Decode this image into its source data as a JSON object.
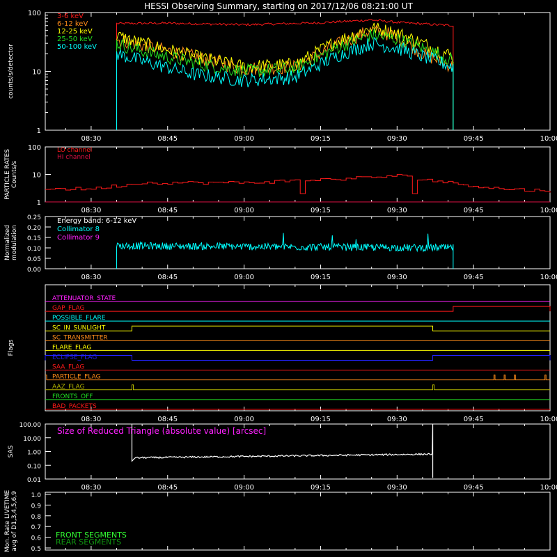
{
  "title": "HESSI Observing Summary, starting on 2017/12/06 08:21:00 UT",
  "time_ticks": [
    "08:30",
    "08:45",
    "09:00",
    "09:15",
    "09:30",
    "09:45",
    "10:00"
  ],
  "colors": {
    "bg": "#000000",
    "axis": "#ffffff",
    "red": "#ff1a1a",
    "orange": "#ff8c1a",
    "yellow": "#ffff00",
    "green": "#22dd22",
    "cyan": "#00ffff",
    "magenta": "#ff22ff",
    "blue": "#2222ff",
    "olive": "#b3b300",
    "crimson": "#dd1144",
    "lightgreen": "#33ff33",
    "darkgreen": "#119911"
  },
  "chart_data": [
    {
      "type": "line",
      "ylabel": "counts/s/detector",
      "yscale": "log",
      "ylim": [
        1,
        100
      ],
      "ytick_labels": [
        "1",
        "10",
        "100"
      ],
      "xlim": [
        "08:21",
        "10:00"
      ],
      "series": [
        {
          "name": "3-6 keV",
          "color": "#ff1a1a",
          "x": [
            "08:35",
            "08:45",
            "09:00",
            "09:15",
            "09:25",
            "09:30",
            "09:41"
          ],
          "values": [
            65,
            66,
            62,
            67,
            75,
            68,
            60
          ]
        },
        {
          "name": "6-12 keV",
          "color": "#ff8c1a",
          "x": [
            "08:35",
            "08:40",
            "08:50",
            "09:00",
            "09:10",
            "09:18",
            "09:25",
            "09:30",
            "09:35",
            "09:41"
          ],
          "values": [
            35,
            28,
            18,
            11,
            12,
            28,
            50,
            40,
            20,
            12
          ]
        },
        {
          "name": "12-25 keV",
          "color": "#ffff00",
          "x": [
            "08:35",
            "08:40",
            "08:50",
            "09:00",
            "09:10",
            "09:18",
            "09:25",
            "09:30",
            "09:35",
            "09:41"
          ],
          "values": [
            40,
            30,
            18,
            12,
            13,
            32,
            55,
            45,
            30,
            18
          ]
        },
        {
          "name": "25-50 keV",
          "color": "#22dd22",
          "x": [
            "08:35",
            "08:40",
            "08:50",
            "09:00",
            "09:10",
            "09:18",
            "09:25",
            "09:30",
            "09:35",
            "09:41"
          ],
          "values": [
            30,
            22,
            14,
            10,
            11,
            25,
            42,
            35,
            25,
            15
          ]
        },
        {
          "name": "50-100 keV",
          "color": "#00ffff",
          "x": [
            "08:35",
            "08:40",
            "08:50",
            "09:00",
            "09:10",
            "09:18",
            "09:25",
            "09:30",
            "09:35",
            "09:41"
          ],
          "values": [
            20,
            15,
            9,
            7,
            8,
            18,
            30,
            25,
            18,
            12
          ]
        }
      ]
    },
    {
      "type": "line",
      "ylabel_lines": [
        "PARTICLE RATES",
        "Counts/s"
      ],
      "yscale": "log",
      "ylim": [
        1,
        100
      ],
      "ytick_labels": [
        "1",
        "10",
        "100"
      ],
      "series": [
        {
          "name": "LO channel",
          "color": "#ff1a1a",
          "x": [
            "08:21",
            "08:30",
            "08:40",
            "09:00",
            "09:20",
            "09:30",
            "09:40",
            "09:50",
            "10:00"
          ],
          "values": [
            3,
            3,
            5,
            5,
            7,
            9,
            5,
            3,
            2.5
          ]
        },
        {
          "name": "HI channel",
          "color": "#dd1144",
          "x": [
            "08:21",
            "10:00"
          ],
          "values": [
            1,
            1
          ]
        }
      ]
    },
    {
      "type": "line",
      "ylabel_lines": [
        "Normalized",
        "modulation"
      ],
      "ylim": [
        0,
        0.25
      ],
      "ytick_labels": [
        "0.00",
        "0.05",
        "0.10",
        "0.15",
        "0.20",
        "0.25"
      ],
      "annotation": "Energy band: 6-12 keV",
      "series": [
        {
          "name": "Collimator 8",
          "color": "#00ffff",
          "x": [
            "08:35",
            "09:41"
          ],
          "values": [
            0.11,
            0.1
          ]
        },
        {
          "name": "Collimator 9",
          "color": "#ff22ff",
          "x": [],
          "values": []
        }
      ]
    },
    {
      "type": "flags",
      "ylabel": "Flags",
      "flags": [
        {
          "name": "ATTENUATOR_STATE",
          "color": "#ff22ff",
          "segments": []
        },
        {
          "name": "GAP_FLAG",
          "color": "#ff1a1a",
          "segments": [
            [
              "09:41",
              "10:00"
            ]
          ]
        },
        {
          "name": "POSSIBLE_FLARE",
          "color": "#00ffff",
          "segments": []
        },
        {
          "name": "SC_IN_SUNLIGHT",
          "color": "#ffff00",
          "segments": [
            [
              "08:38",
              "09:37"
            ]
          ]
        },
        {
          "name": "SC_TRANSMITTER",
          "color": "#ff8c1a",
          "segments": []
        },
        {
          "name": "FLARE_FLAG",
          "color": "#ffff00",
          "segments": []
        },
        {
          "name": "ECLIPSE_FLAG",
          "color": "#2222ff",
          "segments": [
            [
              "08:21",
              "08:38"
            ],
            [
              "09:37",
              "10:00"
            ]
          ]
        },
        {
          "name": "SAA_FLAG",
          "color": "#ff1a1a",
          "segments": []
        },
        {
          "name": "PARTICLE_FLAG",
          "color": "#ff8c1a",
          "segments": []
        },
        {
          "name": "AAZ_FLAG",
          "color": "#b3b300",
          "segments": []
        },
        {
          "name": "FRONTS_OFF",
          "color": "#22dd22",
          "segments": []
        },
        {
          "name": "BAD_PACKETS",
          "color": "#ff1a1a",
          "segments": []
        }
      ]
    },
    {
      "type": "line",
      "ylabel": "SAS",
      "yscale": "log",
      "ylim": [
        0.01,
        100
      ],
      "ytick_labels": [
        "0.01",
        "0.10",
        "1.00",
        "10.00",
        "100.00"
      ],
      "annotation": "Size of Reduced Triangle (absolute value) [arcsec]",
      "series": [
        {
          "color": "#ffffff",
          "x": [
            "08:38",
            "08:39",
            "09:37"
          ],
          "values": [
            100,
            0.35,
            0.65
          ]
        }
      ]
    },
    {
      "type": "line",
      "ylabel_lines": [
        "Mon. Rate LIVETIME",
        "avg of D1,3,4,5,6,9"
      ],
      "ylim": [
        0,
        1
      ],
      "ytick_labels": [
        "0.5",
        "0.6",
        "0.7",
        "0.8",
        "0.9",
        "1.0"
      ],
      "series": [
        {
          "name": "FRONT SEGMENTS",
          "color": "#33ff33",
          "x": [],
          "values": []
        },
        {
          "name": "REAR SEGMENTS",
          "color": "#119911",
          "x": [],
          "values": []
        }
      ]
    }
  ]
}
